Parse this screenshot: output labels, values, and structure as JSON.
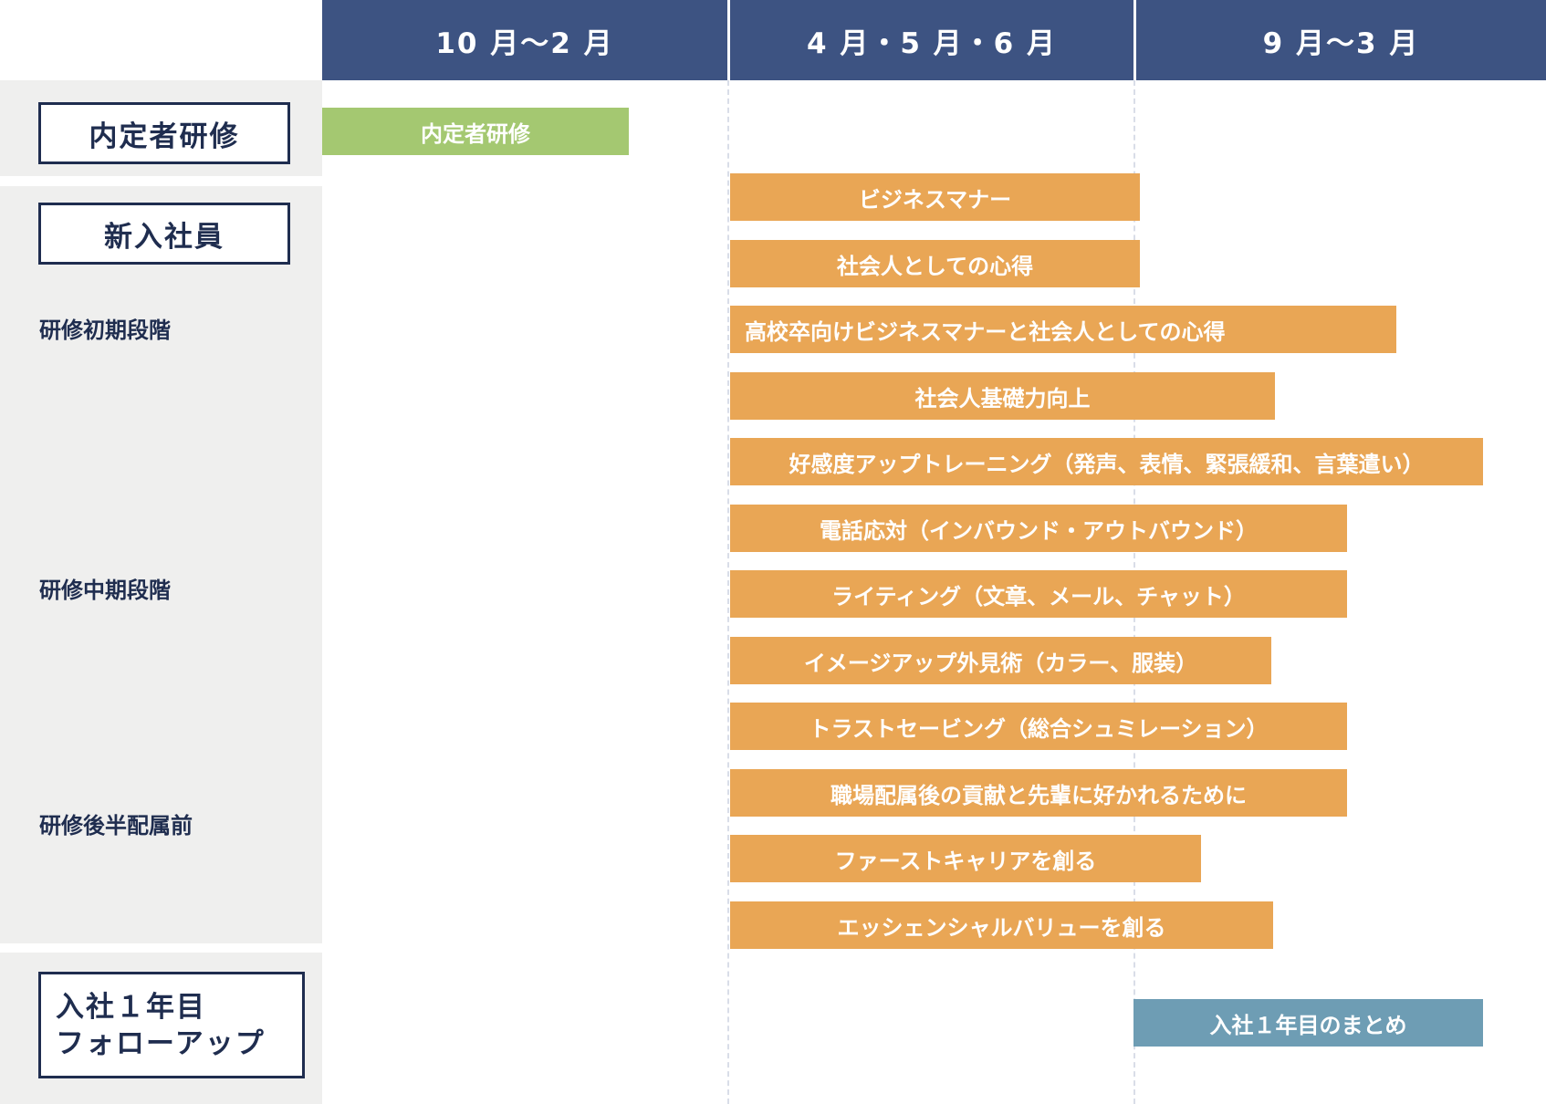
{
  "header": {
    "col1": "10 月〜2 月",
    "col2": "4 月・5 月・6 月",
    "col3": "9 月〜3 月"
  },
  "categories": {
    "pre_employment": "内定者研修",
    "new_employee": "新入社員",
    "first_year_line1": "入社１年目",
    "first_year_line2": "フォローアップ"
  },
  "stages": {
    "initial": "研修初期段階",
    "middle": "研修中期段階",
    "late": "研修後半配属前"
  },
  "bars": {
    "pre_training": "内定者研修",
    "business_manners": "ビジネスマナー",
    "professional_mindset": "社会人としての心得",
    "highschool_manners": "高校卒向けビジネスマナーと社会人としての心得",
    "basic_skills": "社会人基礎力向上",
    "likability_training": "好感度アップトレーニング（発声、表情、緊張緩和、言葉遣い）",
    "phone_handling": "電話応対（インバウンド・アウトバウンド）",
    "writing": "ライティング（文章、メール、チャット）",
    "image_up": "イメージアップ外見術（カラー、服装）",
    "trust_saving": "トラストセービング（総合シュミレーション）",
    "contribution": "職場配属後の貢献と先輩に好かれるために",
    "first_career": "ファーストキャリアを創る",
    "essential_value": "エッシェンシャルバリューを創る",
    "first_year_summary": "入社１年目のまとめ"
  },
  "colors": {
    "header": "#3d5382",
    "panel": "#efefee",
    "category_border": "#1f2d4f",
    "bar_pre_training": "#a4c871",
    "bar_new_employee": "#e9a655",
    "bar_followup": "#6e9db4"
  }
}
